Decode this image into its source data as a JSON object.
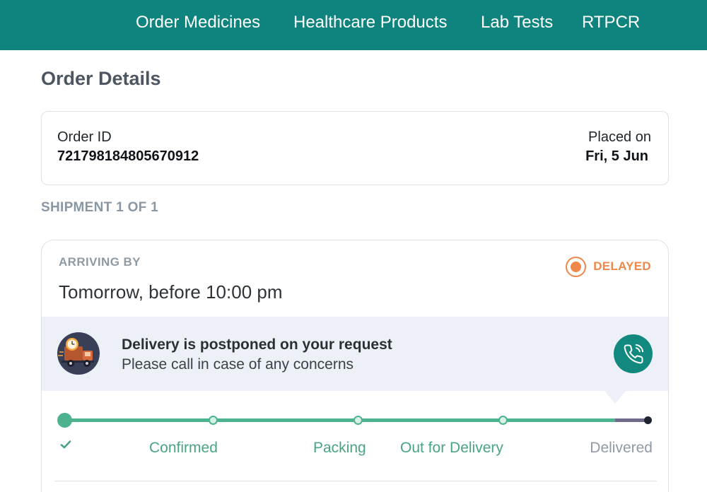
{
  "nav": {
    "items": [
      {
        "label": "Order Medicines"
      },
      {
        "label": "Healthcare Products"
      },
      {
        "label": "Lab Tests"
      },
      {
        "label": "RTPCR"
      }
    ]
  },
  "page": {
    "title": "Order Details"
  },
  "order": {
    "id_label": "Order ID",
    "id_value": "721798184805670912",
    "placed_label": "Placed on",
    "placed_value": "Fri, 5 Jun"
  },
  "shipment": {
    "heading": "SHIPMENT 1 OF 1",
    "arriving_label": "ARRIVING BY",
    "arriving_time": "Tomorrow, before 10:00 pm",
    "status": "DELAYED",
    "notice_title": "Delivery is postponed on your request",
    "notice_subtitle": "Please call in case of any concerns",
    "steps": [
      {
        "label": "Confirmed",
        "state": "done"
      },
      {
        "label": "Packing",
        "state": "done"
      },
      {
        "label": "Out for Delivery",
        "state": "done"
      },
      {
        "label": "Delivered",
        "state": "pending"
      }
    ]
  },
  "colors": {
    "brand": "#0f847e",
    "progress": "#4db38f",
    "status_delayed": "#f0874a",
    "notice_bg": "#edf1f7"
  },
  "icons": {
    "status": "status-dot-icon",
    "delivery": "delivery-truck-icon",
    "call": "phone-call-icon",
    "completed": "checkmark-icon"
  }
}
